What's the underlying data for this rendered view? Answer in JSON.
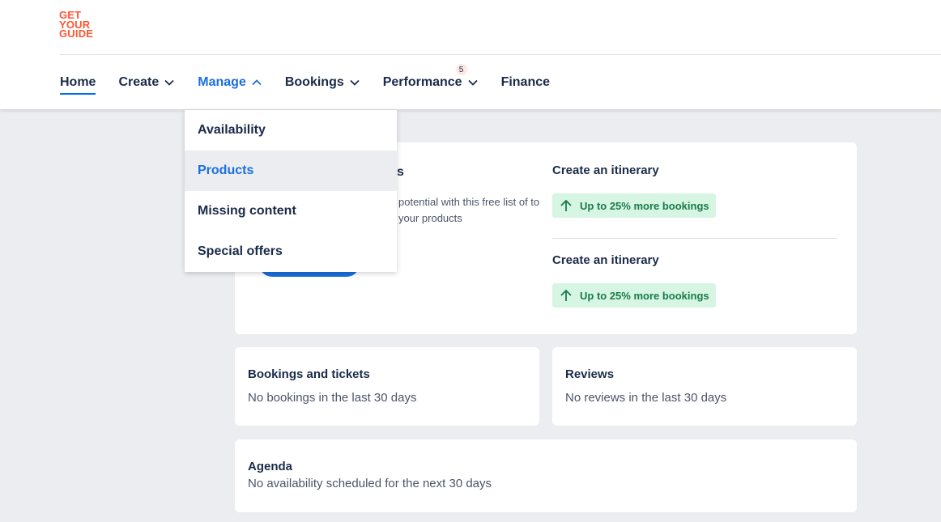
{
  "brand": {
    "logo_lines": [
      "GET",
      "YOUR",
      "GUIDE"
    ],
    "accent": "#ff5533"
  },
  "nav": {
    "home": "Home",
    "create": "Create",
    "manage": "Manage",
    "bookings": "Bookings",
    "performance": "Performance",
    "performance_badge": "5",
    "finance": "Finance"
  },
  "manage_menu": {
    "items": [
      "Availability",
      "Products",
      "Missing content",
      "Special offers"
    ]
  },
  "promo": {
    "partial_title": "s",
    "partial_desc": "potential with this free list of to your products",
    "itineraries": [
      {
        "title": "Create an itinerary",
        "badge": "Up to 25% more bookings"
      },
      {
        "title": "Create an itinerary",
        "badge": "Up to 25% more bookings"
      }
    ]
  },
  "bookings_card": {
    "title": "Bookings and tickets",
    "subtitle": "No bookings in the last 30 days"
  },
  "reviews_card": {
    "title": "Reviews",
    "subtitle": "No reviews in the last 30 days"
  },
  "agenda_card": {
    "title": "Agenda",
    "subtitle": "No availability scheduled for the next 30 days"
  },
  "colors": {
    "link_blue": "#1a6fde",
    "positive_green": "#1b7a4a",
    "positive_bg": "#d6f5e3",
    "text_dark": "#1a2b49"
  }
}
